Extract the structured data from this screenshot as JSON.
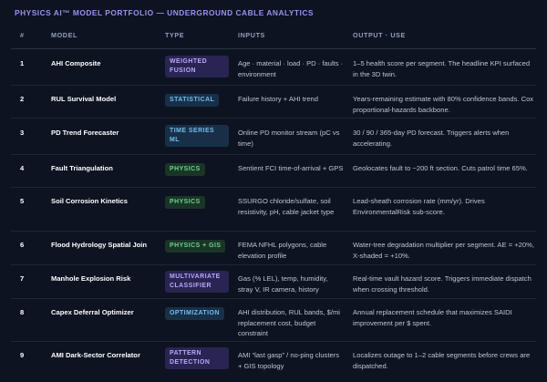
{
  "title": "PHYSICS AI™ MODEL PORTFOLIO — UNDERGROUND CABLE ANALYTICS",
  "headers": [
    "#",
    "MODEL",
    "TYPE",
    "INPUTS",
    "OUTPUT · USE"
  ],
  "rows": [
    {
      "num": "1",
      "model": "AHI Composite",
      "type": "WEIGHTED FUSION",
      "type_style": "purple",
      "inputs": "Age · material · load · PD · faults · environment",
      "output": "1–5 health score per segment. The headline KPI surfaced in the 3D twin."
    },
    {
      "num": "2",
      "model": "RUL Survival Model",
      "type": "STATISTICAL",
      "type_style": "blue",
      "inputs": "Failure history + AHI trend",
      "output": "Years-remaining estimate with 80% confidence bands. Cox proportional-hazards backbone."
    },
    {
      "num": "3",
      "model": "PD Trend Forecaster",
      "type": "TIME SERIES ML",
      "type_style": "blue",
      "inputs": "Online PD monitor stream (pC vs time)",
      "output": "30 / 90 / 365-day PD forecast. Triggers alerts when accelerating."
    },
    {
      "num": "4",
      "model": "Fault Triangulation",
      "type": "PHYSICS",
      "type_style": "green",
      "inputs": "Sentient FCI time-of-arrival + GPS",
      "output": "Geolocates fault to ~200 ft section. Cuts patrol time 65%."
    },
    {
      "num": "5",
      "model": "Soil Corrosion Kinetics",
      "type": "PHYSICS",
      "type_style": "green",
      "inputs": "SSURGO chloride/sulfate, soil resistivity, pH, cable jacket type",
      "output": "Lead-sheath corrosion rate (mm/yr). Drives EnvironmentalRisk sub-score."
    },
    {
      "num": "6",
      "model": "Flood Hydrology Spatial Join",
      "type": "PHYSICS + GIS",
      "type_style": "green",
      "inputs": "FEMA NFHL polygons, cable elevation profile",
      "output": "Water-tree degradation multiplier per segment. AE = +20%, X-shaded = +10%."
    },
    {
      "num": "7",
      "model": "Manhole Explosion Risk",
      "type": "MULTIVARIATE CLASSIFIER",
      "type_style": "purple",
      "inputs": "Gas (% LEL), temp, humidity, stray V, IR camera, history",
      "output": "Real-time vault hazard score. Triggers immediate dispatch when crossing threshold."
    },
    {
      "num": "8",
      "model": "Capex Deferral Optimizer",
      "type": "OPTIMIZATION",
      "type_style": "blue",
      "inputs": "AHI distribution, RUL bands, $/mi replacement cost, budget constraint",
      "output": "Annual replacement schedule that maximizes SAIDI improvement per $ spent."
    },
    {
      "num": "9",
      "model": "AMI Dark-Sector Correlator",
      "type": "PATTERN DETECTION",
      "type_style": "purple",
      "inputs": "AMI “last gasp” / no-ping clusters + GIS topology",
      "output": "Localizes outage to 1–2 cable segments before crews are dispatched."
    }
  ],
  "colors": {
    "background": "#0d1321",
    "title": "#9d8ff2",
    "purple_badge": "#b8a9ff",
    "blue_badge": "#72bef0",
    "green_badge": "#69d58e"
  }
}
